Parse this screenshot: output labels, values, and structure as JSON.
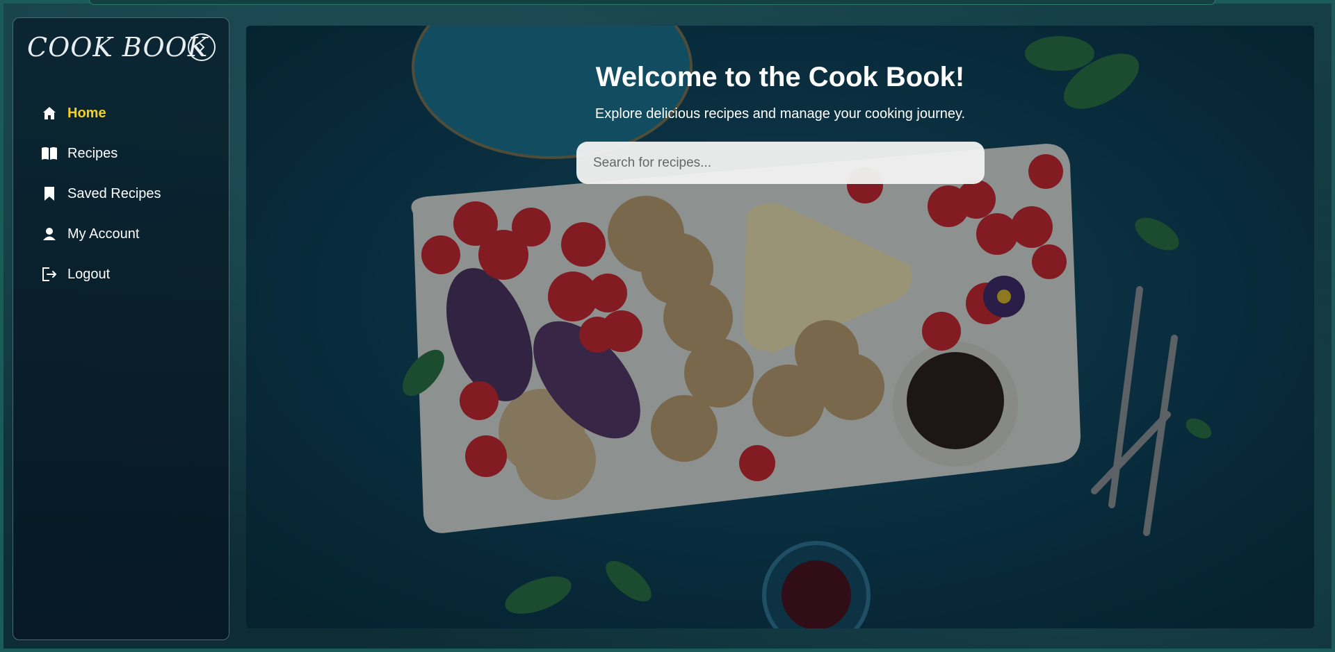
{
  "sidebar": {
    "brand": "COOK BOOK",
    "toggle_icon": "chevron-right-icon",
    "items": [
      {
        "label": "Home",
        "icon": "home-icon",
        "active": true
      },
      {
        "label": "Recipes",
        "icon": "book-open-icon",
        "active": false
      },
      {
        "label": "Saved Recipes",
        "icon": "bookmark-icon",
        "active": false
      },
      {
        "label": "My Account",
        "icon": "user-icon",
        "active": false
      },
      {
        "label": "Logout",
        "icon": "logout-icon",
        "active": false
      }
    ]
  },
  "hero": {
    "title": "Welcome to the Cook Book!",
    "subtitle": "Explore delicious recipes and manage your cooking journey.",
    "search_placeholder": "Search for recipes..."
  },
  "colors": {
    "accent": "#f5d21c",
    "sidebar_bg": "#0a2330",
    "background": "#0f3a40"
  }
}
